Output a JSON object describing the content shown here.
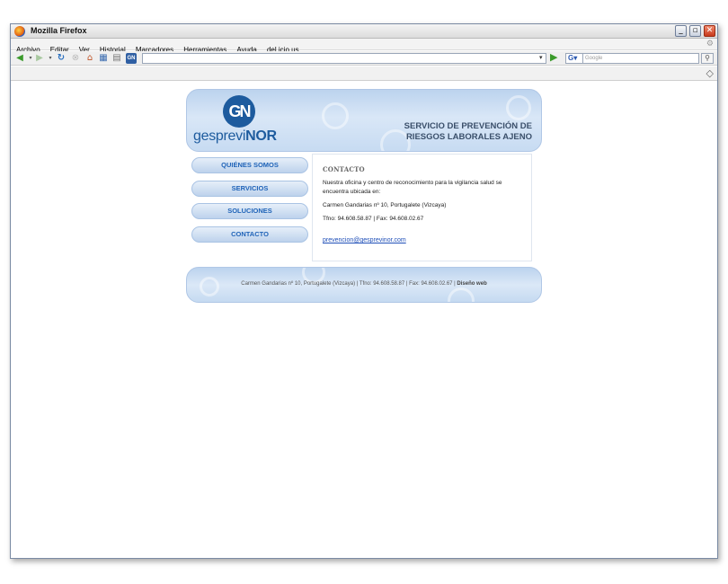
{
  "window": {
    "title": "Mozilla Firefox"
  },
  "menubar": [
    "Archivo",
    "Editar",
    "Ver",
    "Historial",
    "Marcadores",
    "Herramientas",
    "Ayuda",
    "del.icio.us"
  ],
  "toolbar": {
    "url": "",
    "search_engine": "G",
    "search_placeholder": "Google"
  },
  "page": {
    "logo_mark": "GN",
    "logo_text_a": "gesprevi",
    "logo_text_b": "NOR",
    "tagline_line1": "SERVICIO DE PREVENCIÓN DE",
    "tagline_line2": "RIESGOS LABORALES AJENO",
    "menu": [
      "QUIÉNES SOMOS",
      "SERVICIOS",
      "SOLUCIONES",
      "CONTACTO"
    ],
    "content": {
      "heading": "CONTACTO",
      "paragraph1": "Nuestra oficina y centro de reconocimiento para la vigilancia salud se encuentra ubicada en:",
      "address": "Carmen Gandarias nº 10, Portugalete (Vizcaya)",
      "phones": "Tfno: 94.608.58.87 | Fax: 94.608.02.67",
      "email": "prevencion@gesprevinor.com"
    },
    "footer_text": "Carmen Gandarias nº 10, Portugalete (Vizcaya) | Tfno: 94.608.58.87 | Fax: 94.608.02.67 | ",
    "footer_link": "Diseño web"
  },
  "colors": {
    "brand_blue": "#1d5b9e",
    "menu_text": "#1f63b8",
    "banner_light": "#d9e7f7"
  },
  "icons": [
    "firefox-icon",
    "back-icon",
    "forward-icon",
    "reload-icon",
    "stop-icon",
    "home-icon",
    "bookmark-icon",
    "print-icon",
    "site-icon",
    "go-icon",
    "search-icon",
    "gear-icon"
  ]
}
